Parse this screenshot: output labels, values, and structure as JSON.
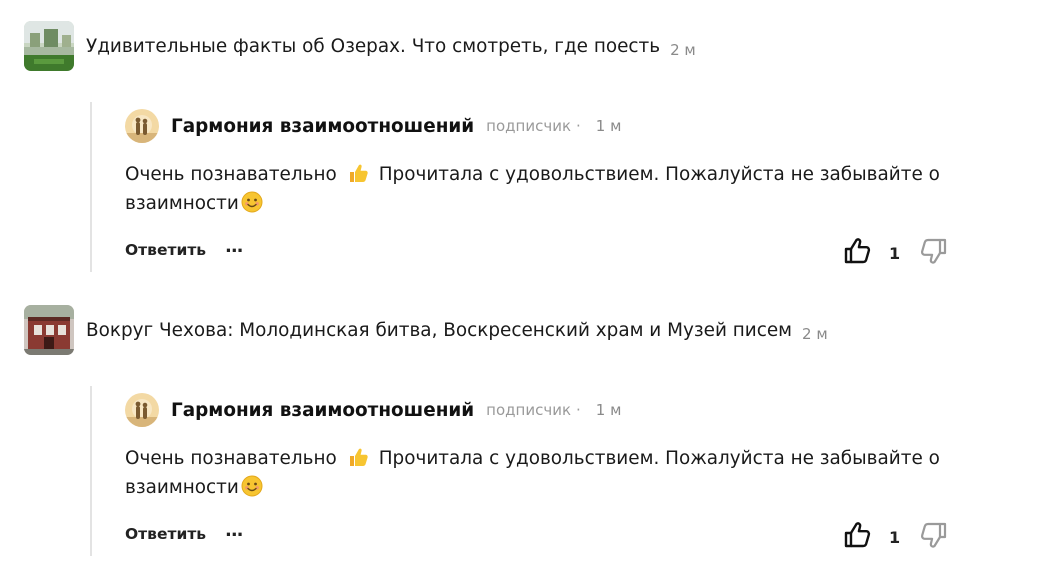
{
  "posts": [
    {
      "thumbnail_icon": "lake-landscape-thumbnail",
      "title": "Удивительные факты об Озерах. Что смотреть, где поесть",
      "time": "2 м",
      "comment": {
        "avatar_icon": "sunset-couple-avatar",
        "author": "Гармония взаимоотношений",
        "badge": "подписчик",
        "separator": "·",
        "time": "1 м",
        "text_part1": "Очень познавательно",
        "text_part2": "Прочитала с удовольствием. Пожалуйста не забывайте о взаимности",
        "reply_label": "Ответить",
        "more_label": "...",
        "likes": "1"
      }
    },
    {
      "thumbnail_icon": "museum-building-thumbnail",
      "title": "Вокруг Чехова: Молодинская битва, Воскресенский храм и Музей писем",
      "time": "2 м",
      "comment": {
        "avatar_icon": "sunset-couple-avatar",
        "author": "Гармония взаимоотношений",
        "badge": "подписчик",
        "separator": "·",
        "time": "1 м",
        "text_part1": "Очень познавательно",
        "text_part2": "Прочитала с удовольствием. Пожалуйста не забывайте о взаимности",
        "reply_label": "Ответить",
        "more_label": "...",
        "likes": "1"
      }
    }
  ],
  "colors": {
    "thread_line": "#e3e3e3",
    "muted_text": "#8a8a8a",
    "emoji_yellow": "#f7c531"
  }
}
